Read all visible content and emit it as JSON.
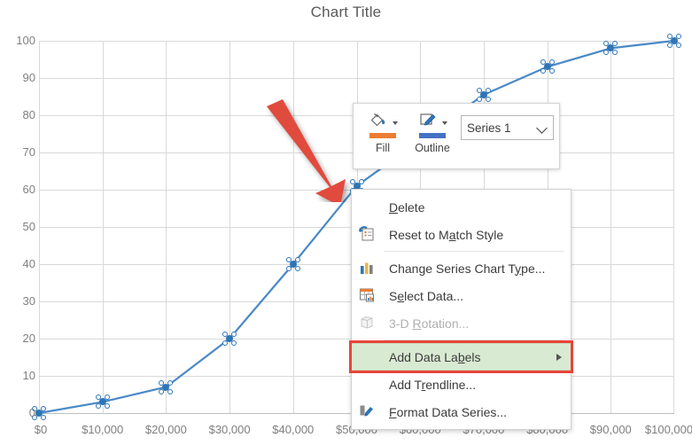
{
  "chart_data": {
    "type": "line",
    "title": "Chart Title",
    "xlabel": "",
    "ylabel": "",
    "xlim": [
      0,
      100000
    ],
    "ylim": [
      0,
      100
    ],
    "grid": true,
    "legend": false,
    "series": [
      {
        "name": "Series 1",
        "color": "#4A89C8",
        "x": [
          0,
          10000,
          20000,
          30000,
          40000,
          50000,
          70000,
          80000,
          90000,
          100000
        ],
        "values": [
          0,
          3,
          7,
          20,
          40,
          61,
          85.5,
          93,
          98,
          100
        ],
        "selected": true
      }
    ],
    "x_ticks": [
      "$0",
      "$10,000",
      "$20,000",
      "$30,000",
      "$40,000",
      "$50,000",
      "$60,000",
      "$70,000",
      "$80,000",
      "$90,000",
      "$100,000"
    ],
    "x_tick_values": [
      0,
      10000,
      20000,
      30000,
      40000,
      50000,
      60000,
      70000,
      80000,
      90000,
      100000
    ],
    "y_ticks": [
      "0",
      "10",
      "20",
      "30",
      "40",
      "50",
      "60",
      "70",
      "80",
      "90",
      "100"
    ],
    "y_tick_values": [
      0,
      10,
      20,
      30,
      40,
      50,
      60,
      70,
      80,
      90,
      100
    ],
    "annotations": [
      {
        "type": "arrow",
        "color": "#E04B3C",
        "points_to_x": 50000,
        "points_to_y": 61
      }
    ]
  },
  "mini_toolbar": {
    "fill": {
      "label": "Fill",
      "icon": "paint-bucket-icon",
      "color": "#ED7D31"
    },
    "outline": {
      "label": "Outline",
      "icon": "pencil-outline-icon",
      "color": "#4472C4"
    },
    "series_select": {
      "value": "Series 1",
      "icon": "chevron-down-icon"
    }
  },
  "context_menu": {
    "items": [
      {
        "label": "Delete",
        "accel": "D",
        "icon": null,
        "disabled": false,
        "highlighted": false,
        "submenu": false,
        "separator_after": false
      },
      {
        "label": "Reset to Match Style",
        "accel": "a",
        "icon": "reset-style-icon",
        "disabled": false,
        "highlighted": false,
        "submenu": false,
        "separator_after": true
      },
      {
        "label": "Change Series Chart Type...",
        "accel": "y",
        "icon": "chart-type-icon",
        "disabled": false,
        "highlighted": false,
        "submenu": false,
        "separator_after": false
      },
      {
        "label": "Select Data...",
        "accel": "e",
        "icon": "select-data-icon",
        "disabled": false,
        "highlighted": false,
        "submenu": false,
        "separator_after": false
      },
      {
        "label": "3-D Rotation...",
        "accel": "R",
        "icon": "rotation-3d-icon",
        "disabled": true,
        "highlighted": false,
        "submenu": false,
        "separator_after": true
      },
      {
        "label": "Add Data Labels",
        "accel": "b",
        "icon": null,
        "disabled": false,
        "highlighted": true,
        "submenu": true,
        "separator_after": false
      },
      {
        "label": "Add Trendline...",
        "accel": "r",
        "icon": null,
        "disabled": false,
        "highlighted": false,
        "submenu": false,
        "separator_after": false
      },
      {
        "label": "Format Data Series...",
        "accel": "F",
        "icon": "format-series-icon",
        "disabled": false,
        "highlighted": false,
        "submenu": false,
        "separator_after": false
      }
    ],
    "highlight_box_color": "#E8443A"
  }
}
